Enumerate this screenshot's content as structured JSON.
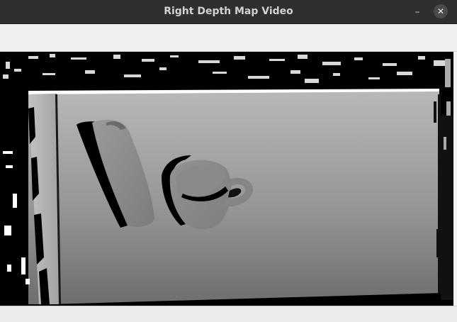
{
  "window": {
    "title": "Right Depth Map Video",
    "minimize_glyph": "–",
    "close_glyph": "✕"
  },
  "icons": {
    "minimize": "minimize-icon",
    "close": "close-icon"
  },
  "colors": {
    "titlebar": "#2f2f2f",
    "title_text": "#d2d2d2",
    "background_far": "#000000",
    "near_highlight": "#ffffff",
    "table_surface_top": "#b9b9b9",
    "table_surface_bottom": "#6f6f6f",
    "object_gray": "#8a8a8a"
  },
  "video": {
    "content": "depth-map",
    "objects": [
      "bottle",
      "cup"
    ]
  }
}
